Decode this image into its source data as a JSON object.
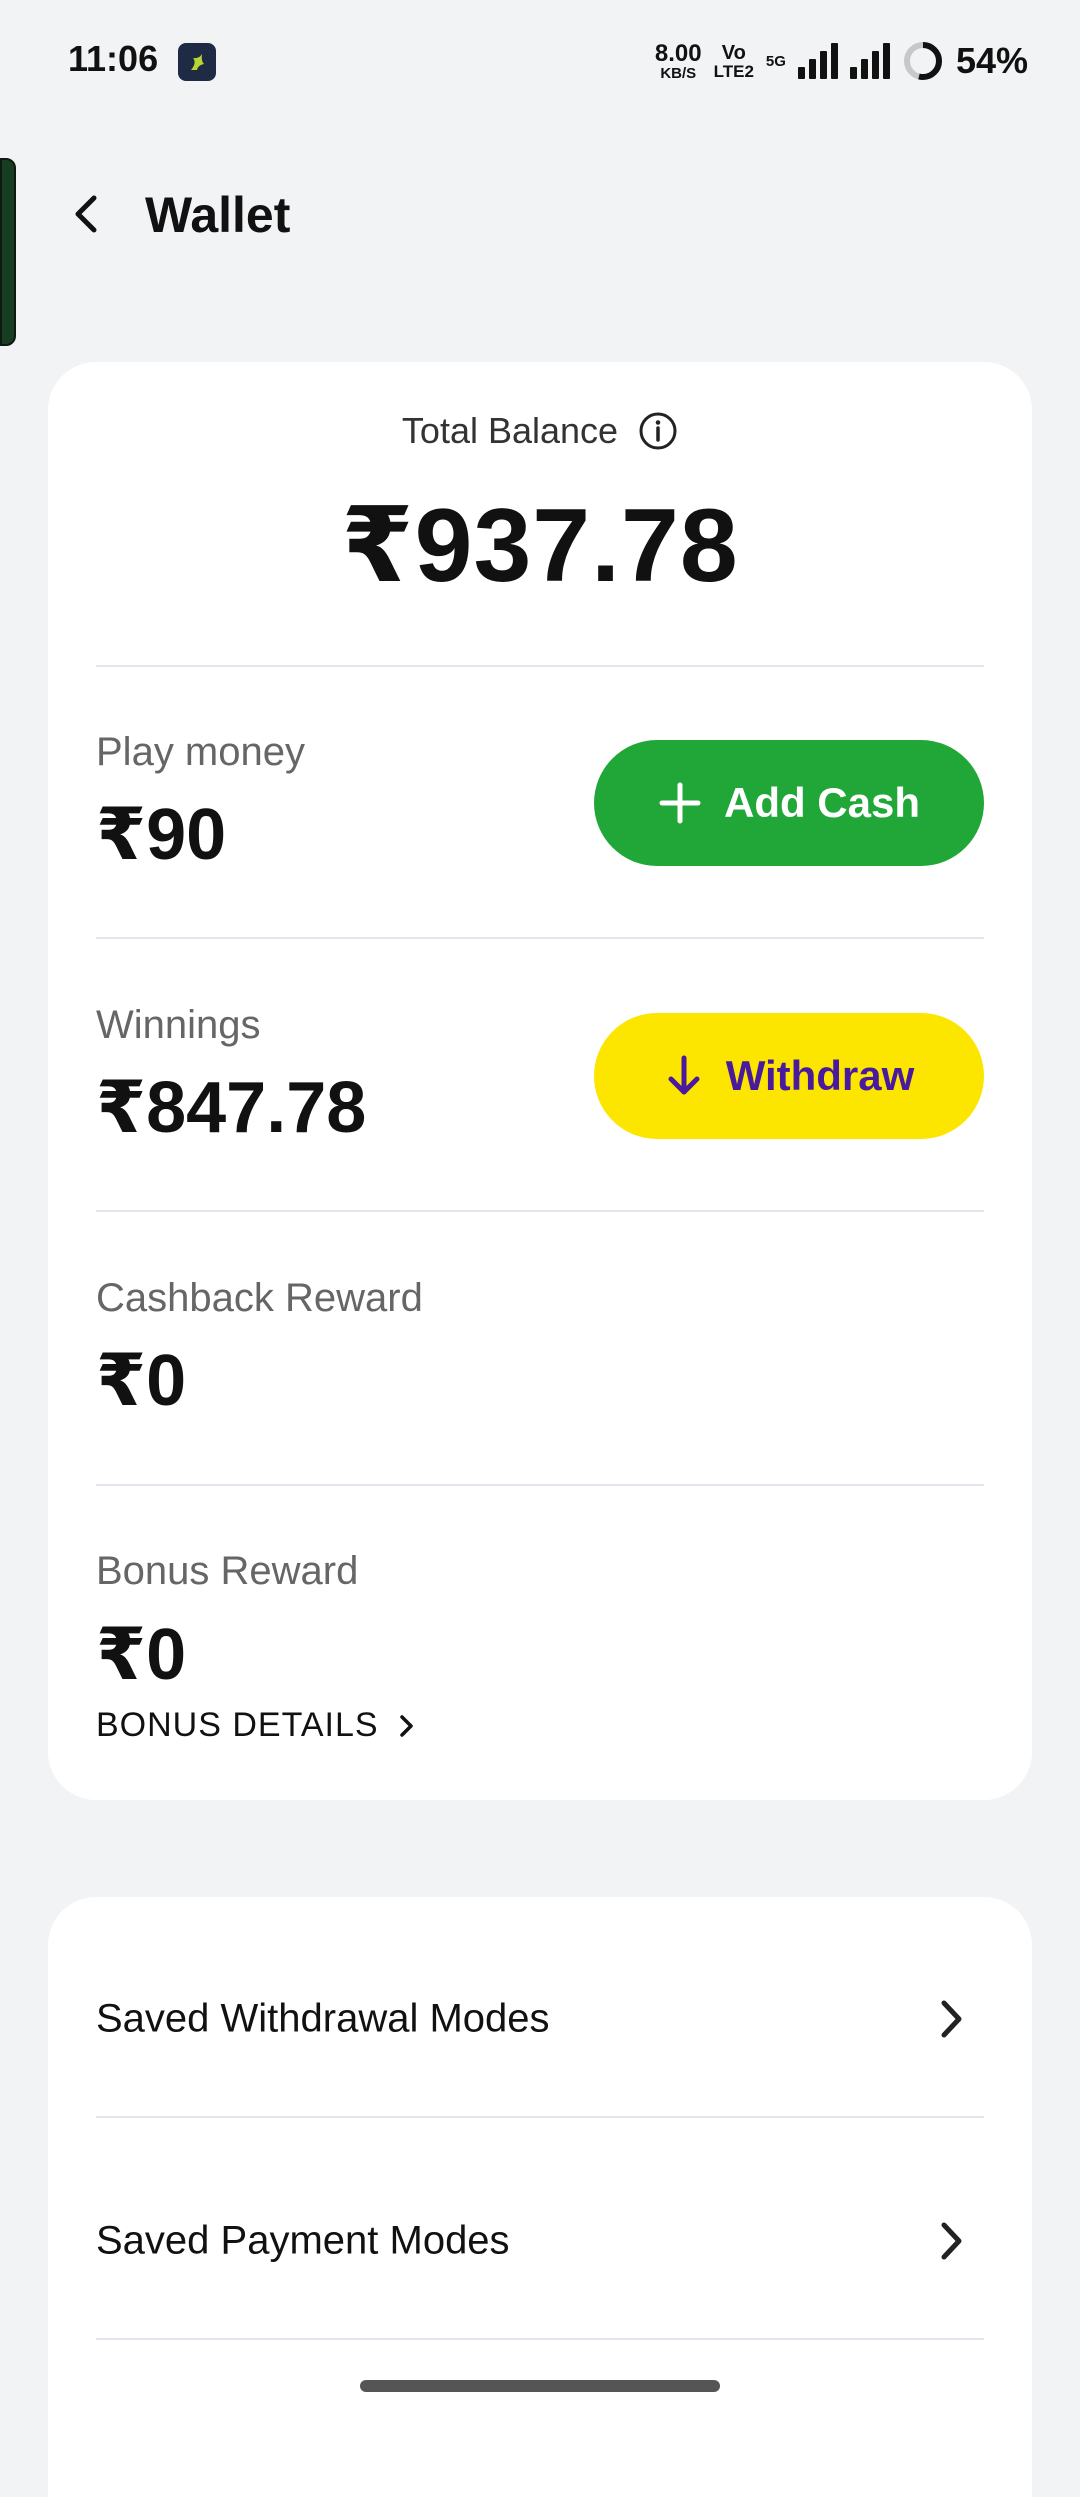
{
  "status_bar": {
    "time": "11:06",
    "net_speed_value": "8.00",
    "net_speed_unit": "KB/S",
    "volte_top": "Vo",
    "volte_bottom": "LTE2",
    "network_type": "5G",
    "battery_percent": "54%",
    "battery_level": 0.54
  },
  "header": {
    "title": "Wallet"
  },
  "balance": {
    "total_label": "Total Balance",
    "total_amount": "₹937.78",
    "rows": [
      {
        "label": "Play money",
        "amount": "₹90",
        "action": "Add Cash"
      },
      {
        "label": "Winnings",
        "amount": "₹847.78",
        "action": "Withdraw"
      },
      {
        "label": "Cashback Reward",
        "amount": "₹0"
      },
      {
        "label": "Bonus Reward",
        "amount": "₹0"
      }
    ],
    "bonus_details_link": "BONUS DETAILS"
  },
  "modes": {
    "items": [
      {
        "label": "Saved Withdrawal Modes"
      },
      {
        "label": "Saved Payment Modes"
      }
    ]
  },
  "colors": {
    "add_cash": "#21a738",
    "withdraw": "#fce600",
    "withdraw_text": "#4a1a9e"
  }
}
